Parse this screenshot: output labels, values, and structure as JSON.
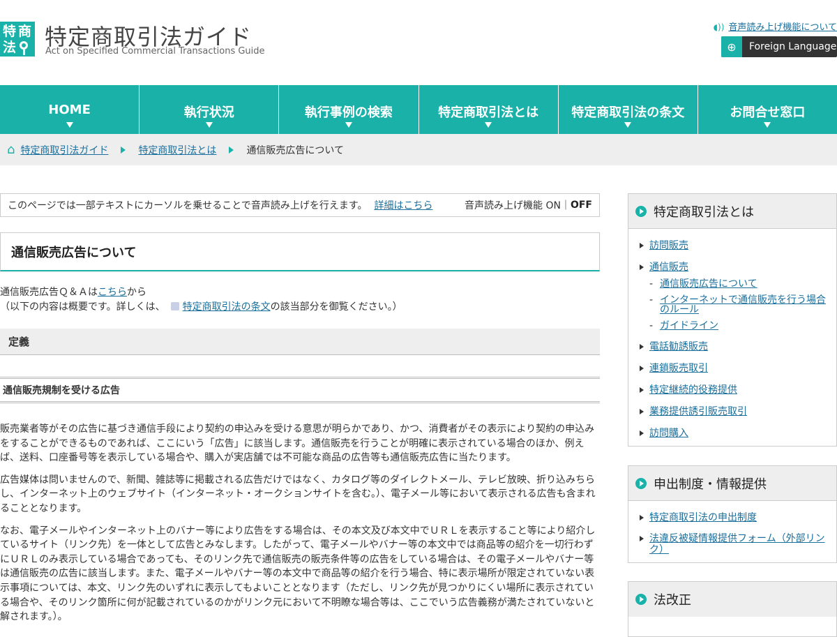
{
  "header": {
    "logo_chars": [
      "特",
      "商",
      "法"
    ],
    "title": "特定商取引法ガイド",
    "subtitle": "Act on Specified Commercial Transactions Guide",
    "voice_link": "音声読み上げ機能について",
    "foreign_button": "Foreign Language"
  },
  "nav": {
    "items": [
      "HOME",
      "執行状況",
      "執行事例の検索",
      "特定商取引法とは",
      "特定商取引法の条文",
      "お問合せ窓口"
    ]
  },
  "breadcrumb": {
    "items": [
      "特定商取引法ガイド",
      "特定商取引法とは"
    ],
    "current": "通信販売広告について"
  },
  "voice_bar": {
    "text": "このページでは一部テキストにカーソルを乗せることで音声読み上げを行えます。",
    "link": "詳細はこちら",
    "label": "音声読み上げ機能 ON｜",
    "off": "OFF"
  },
  "page_title": "通信販売広告について",
  "intro": {
    "line1_prefix": "通信販売広告Ｑ＆Ａは",
    "line1_link": "こちら",
    "line1_suffix": "から",
    "line2_prefix": "（以下の内容は概要です。詳しくは、",
    "line2_link": "特定商取引法の条文",
    "line2_suffix": "の該当部分を御覧ください。）"
  },
  "section": {
    "heading": "定義",
    "subheading": "通信販売規制を受ける広告",
    "paragraphs": [
      "販売業者等がその広告に基づき通信手段により契約の申込みを受ける意思が明らかであり、かつ、消費者がその表示により契約の申込みをすることができるものであれば、ここにいう「広告」に該当します。通信販売を行うことが明確に表示されている場合のほか、例えば、送料、口座番号等を表示している場合や、購入が実店舗では不可能な商品の広告等も通信販売広告に当たります。",
      "広告媒体は問いませんので、新聞、雑誌等に掲載される広告だけではなく、カタログ等のダイレクトメール、テレビ放映、折り込みちらし、インターネット上のウェブサイト（インターネット・オークションサイトを含む。）、電子メール等において表示される広告も含まれることとなります。",
      "なお、電子メールやインターネット上のバナー等により広告をする場合は、その本文及び本文中でＵＲＬを表示すること等により紹介しているサイト（リンク先）を一体として広告とみなします。したがって、電子メールやバナー等の本文中では商品等の紹介を一切行わずにＵＲＬのみ表示している場合であっても、そのリンク先で通信販売の販売条件等の広告をしている場合は、その電子メールやバナー等は通信販売の広告に該当します。また、電子メールやバナー等の本文中で商品等の紹介を行う場合、特に表示場所が限定されていない表示事項については、本文、リンク先のいずれに表示してもよいこととなります（ただし、リンク先が見つかりにくい場所に表示されている場合や、そのリンク箇所に何が記載されているのかがリンク元において不明瞭な場合等は、ここでいう広告義務が満たされていないと解されます。）。"
    ]
  },
  "sidebar": {
    "box1": {
      "title": "特定商取引法とは",
      "items": [
        "訪問販売",
        "通信販売"
      ],
      "sub_items": [
        "通信販売広告について",
        "インターネットで通信販売を行う場合のルール",
        "ガイドライン"
      ],
      "items_after": [
        "電話勧誘販売",
        "連鎖販売取引",
        "特定継続的役務提供",
        "業務提供誘引販売取引",
        "訪問購入"
      ]
    },
    "box2": {
      "title": "申出制度・情報提供",
      "items": [
        "特定商取引法の申出制度",
        "法違反被疑情報提供フォーム（外部リンク）"
      ]
    },
    "box3": {
      "title": "法改正"
    }
  }
}
